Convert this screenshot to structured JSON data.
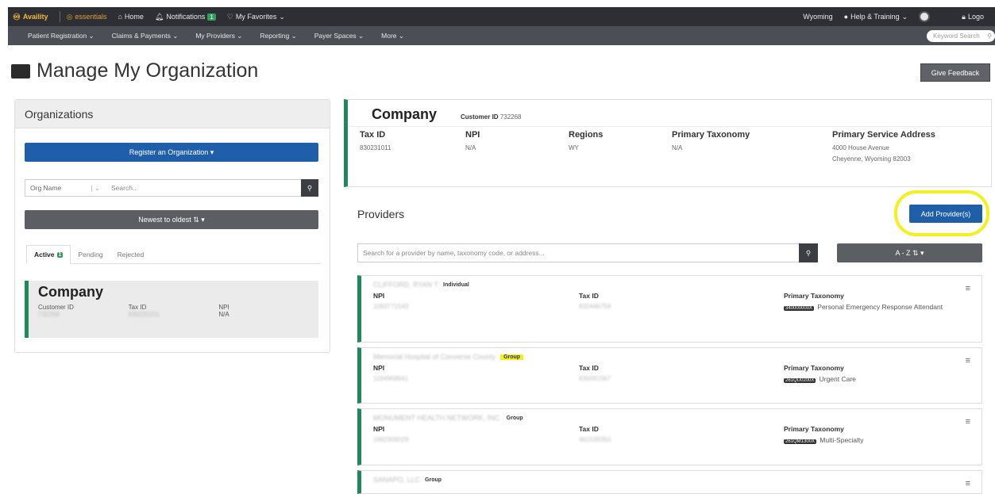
{
  "topbar": {
    "logo": "Availity",
    "essentials": "essentials",
    "home": "Home",
    "notifications": "Notifications",
    "notifications_count": "1",
    "favorites": "My Favorites",
    "state": "Wyoming",
    "help": "Help & Training",
    "logout": "Logo"
  },
  "navbar": {
    "items": [
      "Patient Registration",
      "Claims & Payments",
      "My Providers",
      "Reporting",
      "Payer Spaces",
      "More"
    ],
    "search_placeholder": "Keyword Search"
  },
  "page": {
    "title": "Manage My Organization",
    "feedback": "Give Feedback"
  },
  "organizations": {
    "header": "Organizations",
    "register": "Register an Organization ▾",
    "filter": "Org Name",
    "search_placeholder": "Search...",
    "sort": "Newest to oldest ⇅ ▾",
    "tabs": {
      "active": "Active",
      "active_count": "1",
      "pending": "Pending",
      "rejected": "Rejected"
    },
    "card": {
      "name": "Company",
      "customer_id_label": "Customer ID",
      "customer_id": "732268",
      "tax_id_label": "Tax ID",
      "tax_id": "830231011",
      "npi_label": "NPI",
      "npi": "N/A"
    }
  },
  "company": {
    "name": "Company",
    "customer_id_label": "Customer ID",
    "customer_id": "732268",
    "tax_id_label": "Tax ID",
    "tax_id": "830231011",
    "npi_label": "NPI",
    "npi": "N/A",
    "regions_label": "Regions",
    "regions": "WY",
    "taxonomy_label": "Primary Taxonomy",
    "taxonomy": "N/A",
    "address_label": "Primary Service Address",
    "address_line1": "4000 House Avenue",
    "address_line2": "Cheyenne, Wyoming 82003"
  },
  "providers": {
    "title": "Providers",
    "add": "Add Provider(s)",
    "search_placeholder": "Search for a provider by name, taxonomy code, or address...",
    "sort": "A - Z ⇅ ▾",
    "npi_label": "NPI",
    "tax_id_label": "Tax ID",
    "taxonomy_label": "Primary Taxonomy",
    "list": [
      {
        "name": "CLIFFORD, RYAN T",
        "type": "Individual",
        "npi": "1093771543",
        "tax_id": "832446759",
        "tax_code": "340000000X",
        "tax_desc": "Personal Emergency Response Attendant"
      },
      {
        "name": "Memorial Hospital of Converse County",
        "type": "Group",
        "npi": "1194968941",
        "tax_id": "830091567",
        "tax_code": "261QU0200X",
        "tax_desc": "Urgent Care"
      },
      {
        "name": "MONUMENT HEALTH NETWORK, INC.",
        "type": "Group",
        "npi": "1992309029",
        "tax_id": "461539350",
        "tax_code": "261QM1300X",
        "tax_desc": "Multi-Specialty"
      },
      {
        "name": "SANAPO, LLC",
        "type": "Group"
      }
    ]
  }
}
